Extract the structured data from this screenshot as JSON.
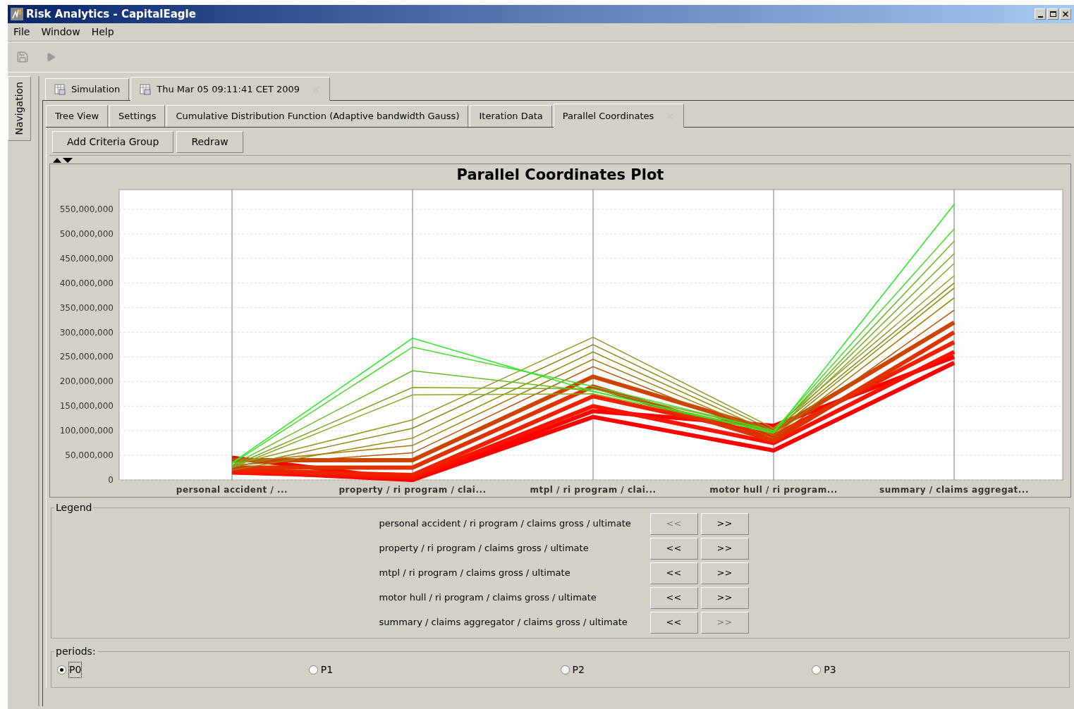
{
  "window": {
    "title": "Risk Analytics - CapitalEagle"
  },
  "menu": [
    "File",
    "Window",
    "Help"
  ],
  "side_tab": {
    "label": "Navigation"
  },
  "outer_tabs": [
    {
      "label": "Simulation",
      "selected": false,
      "closable": false
    },
    {
      "label": "Thu Mar 05 09:11:41 CET 2009",
      "selected": true,
      "closable": true
    }
  ],
  "inner_tabs": [
    {
      "label": "Tree View",
      "selected": false,
      "closable": false
    },
    {
      "label": "Settings",
      "selected": false,
      "closable": false
    },
    {
      "label": "Cumulative Distribution Function (Adaptive bandwidth Gauss)",
      "selected": false,
      "closable": false
    },
    {
      "label": "Iteration Data",
      "selected": false,
      "closable": false
    },
    {
      "label": "Parallel Coordinates",
      "selected": true,
      "closable": true
    }
  ],
  "buttons": [
    "Add Criteria Group",
    "Redraw"
  ],
  "chart": {
    "chart_data": {
      "type": "line",
      "title": "Parallel Coordinates Plot",
      "grid": true,
      "categories": [
        "personal accident / ...",
        "property / ri program / clai...",
        "mtpl / ri program / clai...",
        "motor hull / ri program...",
        "summary / claims aggregat..."
      ],
      "ylim": [
        0,
        590000000
      ],
      "yticks": [
        {
          "value": 0,
          "label": "0"
        },
        {
          "value": 50000000,
          "label": "50,000,000"
        },
        {
          "value": 100000000,
          "label": "100,000,000"
        },
        {
          "value": 150000000,
          "label": "150,000,000"
        },
        {
          "value": 200000000,
          "label": "200,000,000"
        },
        {
          "value": 250000000,
          "label": "250,000,000"
        },
        {
          "value": 300000000,
          "label": "300,000,000"
        },
        {
          "value": 350000000,
          "label": "350,000,000"
        },
        {
          "value": 400000000,
          "label": "400,000,000"
        },
        {
          "value": 450000000,
          "label": "450,000,000"
        },
        {
          "value": 500000000,
          "label": "500,000,000"
        },
        {
          "value": 550000000,
          "label": "550,000,000"
        }
      ],
      "series": [
        {
          "color": "#ff0000",
          "values": [
            45000000,
            0,
            140000000,
            110000000,
            250000000
          ]
        },
        {
          "color": "#ff0000",
          "values": [
            18000000,
            0,
            128000000,
            60000000,
            238000000
          ]
        },
        {
          "color": "#ff1100",
          "values": [
            15000000,
            5000000,
            150000000,
            75000000,
            260000000
          ]
        },
        {
          "color": "#ee2200",
          "values": [
            20000000,
            10000000,
            170000000,
            90000000,
            280000000
          ]
        },
        {
          "color": "#dd3300",
          "values": [
            25000000,
            25000000,
            190000000,
            80000000,
            300000000
          ]
        },
        {
          "color": "#cc4400",
          "values": [
            40000000,
            40000000,
            210000000,
            100000000,
            320000000
          ]
        },
        {
          "color": "#bb5500",
          "values": [
            30000000,
            55000000,
            230000000,
            85000000,
            345000000
          ]
        },
        {
          "color": "#aa7700",
          "values": [
            35000000,
            70000000,
            245000000,
            90000000,
            370000000
          ]
        },
        {
          "color": "#998800",
          "values": [
            20000000,
            85000000,
            260000000,
            95000000,
            390000000
          ]
        },
        {
          "color": "#8a8a1a",
          "values": [
            25000000,
            105000000,
            275000000,
            100000000,
            400000000
          ]
        },
        {
          "color": "#999922",
          "values": [
            30000000,
            122000000,
            290000000,
            105000000,
            415000000
          ]
        },
        {
          "color": "#88aa22",
          "values": [
            25000000,
            173000000,
            175000000,
            97000000,
            440000000
          ]
        },
        {
          "color": "#77aa22",
          "values": [
            28000000,
            188000000,
            185000000,
            100000000,
            460000000
          ]
        },
        {
          "color": "#66bb22",
          "values": [
            30000000,
            222000000,
            180000000,
            98000000,
            485000000
          ]
        },
        {
          "color": "#44dd22",
          "values": [
            33000000,
            270000000,
            190000000,
            100000000,
            510000000
          ]
        },
        {
          "color": "#22ee22",
          "values": [
            35000000,
            288000000,
            180000000,
            95000000,
            560000000
          ]
        }
      ]
    }
  },
  "legend": {
    "title": "Legend",
    "rows": [
      {
        "label": "personal accident / ri program / claims gross / ultimate",
        "back": "<<",
        "forward": ">>",
        "back_disabled": true,
        "forward_disabled": false
      },
      {
        "label": "property / ri program / claims gross / ultimate",
        "back": "<<",
        "forward": ">>",
        "back_disabled": false,
        "forward_disabled": false
      },
      {
        "label": "mtpl / ri program / claims gross / ultimate",
        "back": "<<",
        "forward": ">>",
        "back_disabled": false,
        "forward_disabled": false
      },
      {
        "label": "motor hull / ri program / claims gross / ultimate",
        "back": "<<",
        "forward": ">>",
        "back_disabled": false,
        "forward_disabled": false
      },
      {
        "label": "summary / claims aggregator / claims gross / ultimate",
        "back": "<<",
        "forward": ">>",
        "back_disabled": false,
        "forward_disabled": true
      }
    ]
  },
  "periods": {
    "title": "periods:",
    "options": [
      {
        "label": "P0",
        "selected": true
      },
      {
        "label": "P1",
        "selected": false
      },
      {
        "label": "P2",
        "selected": false
      },
      {
        "label": "P3",
        "selected": false
      }
    ]
  }
}
